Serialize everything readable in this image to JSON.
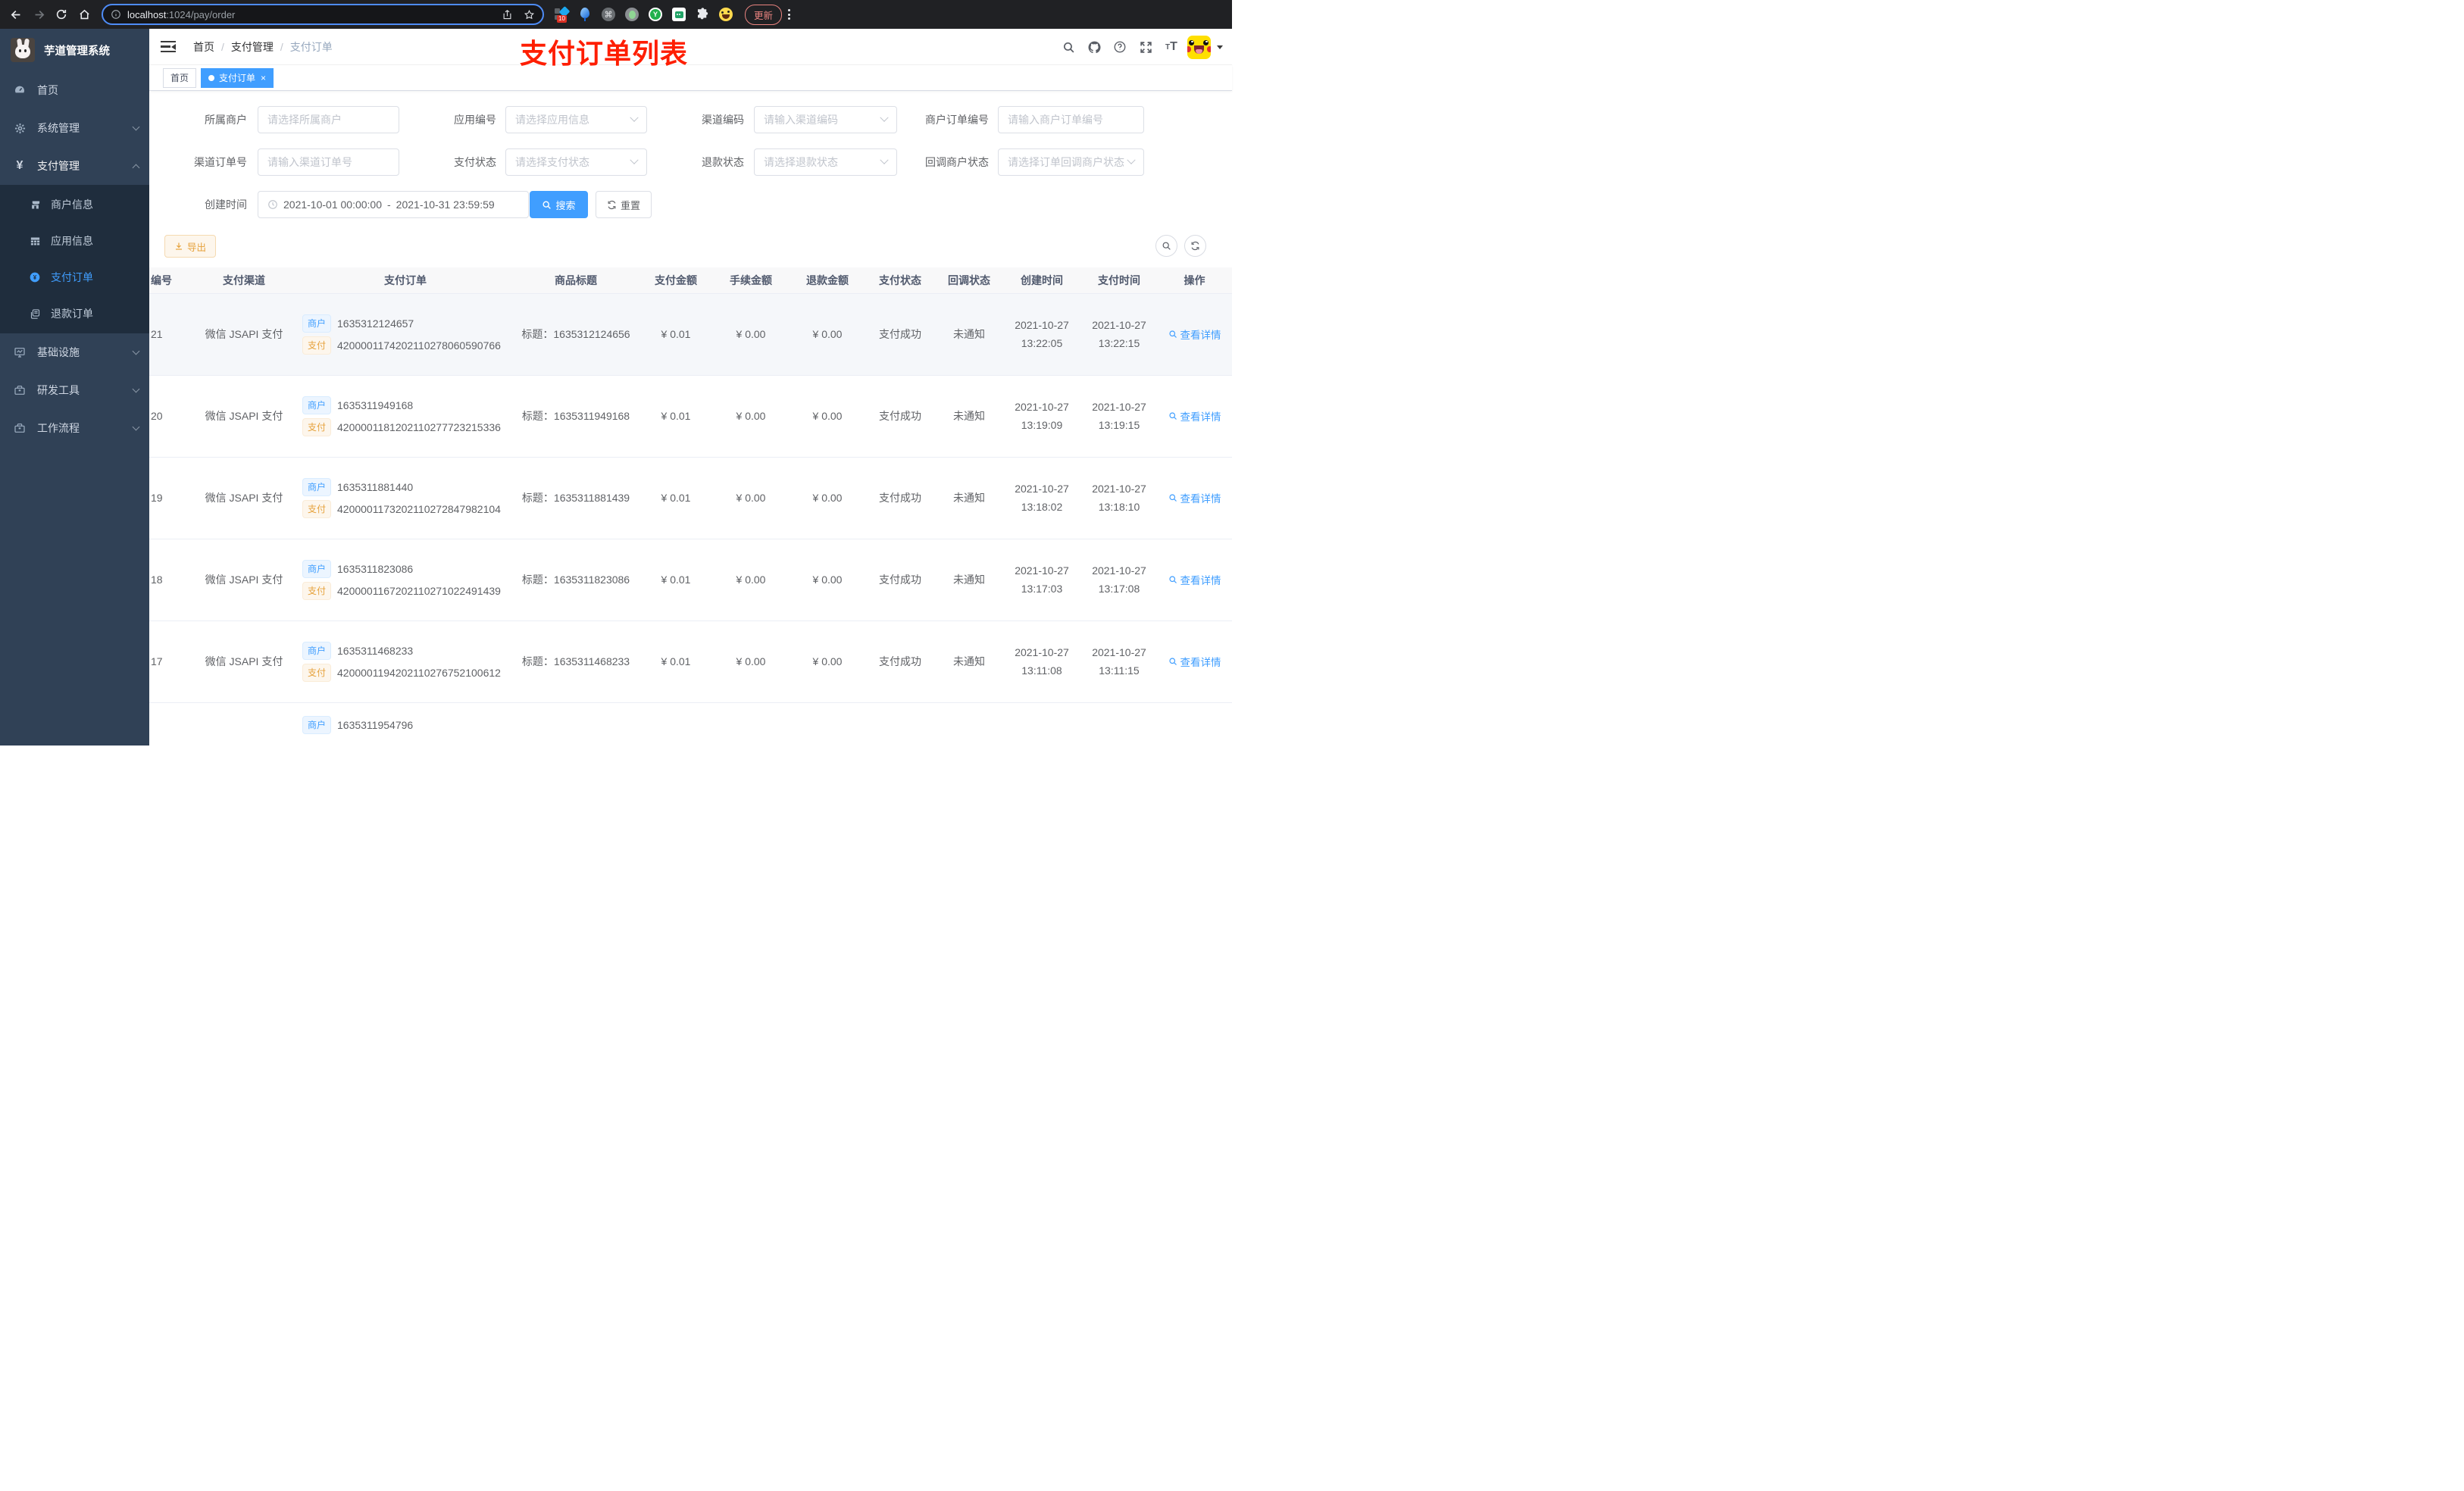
{
  "browser": {
    "url_host": "localhost",
    "url_rest": ":1024/pay/order",
    "ext_badge": "10",
    "ext_y": "Y",
    "update_label": "更新"
  },
  "sidebar": {
    "app_title": "芋道管理系统",
    "menu_home": "首页",
    "menu_system": "系统管理",
    "menu_pay": "支付管理",
    "sub_merchant": "商户信息",
    "sub_app": "应用信息",
    "sub_pay_order": "支付订单",
    "sub_refund_order": "退款订单",
    "menu_infra": "基础设施",
    "menu_devtool": "研发工具",
    "menu_workflow": "工作流程"
  },
  "navbar": {
    "breadcrumb_home": "首页",
    "breadcrumb_pay": "支付管理",
    "breadcrumb_order": "支付订单",
    "annotation": "支付订单列表"
  },
  "tags": {
    "home": "首页",
    "active": "支付订单",
    "close": "×"
  },
  "filters": {
    "merchant": {
      "label": "所属商户",
      "placeholder": "请选择所属商户"
    },
    "app": {
      "label": "应用编号",
      "placeholder": "请选择应用信息"
    },
    "channel_code": {
      "label": "渠道编码",
      "placeholder": "请输入渠道编码"
    },
    "merchant_order_no": {
      "label": "商户订单编号",
      "placeholder": "请输入商户订单编号"
    },
    "channel_order_no": {
      "label": "渠道订单号",
      "placeholder": "请输入渠道订单号"
    },
    "pay_status": {
      "label": "支付状态",
      "placeholder": "请选择支付状态"
    },
    "refund_status": {
      "label": "退款状态",
      "placeholder": "请选择退款状态"
    },
    "callback_status": {
      "label": "回调商户状态",
      "placeholder": "请选择订单回调商户状态"
    },
    "create_time": {
      "label": "创建时间",
      "start": "2021-10-01 00:00:00",
      "separator": "-",
      "end": "2021-10-31 23:59:59"
    },
    "search_label": "搜索",
    "reset_label": "重置"
  },
  "toolbar": {
    "export_label": "导出"
  },
  "table": {
    "headers": [
      "编号",
      "支付渠道",
      "支付订单",
      "商品标题",
      "支付金额",
      "手续金额",
      "退款金额",
      "支付状态",
      "回调状态",
      "创建时间",
      "支付时间",
      "操作"
    ],
    "tag_merchant": "商户",
    "tag_pay": "支付",
    "title_prefix": "标题：",
    "rows": [
      {
        "id": "21",
        "channel": "微信 JSAPI 支付",
        "mch_no": "1635312124657",
        "pay_no": "4200001174202110278060590766",
        "title": "1635312124656",
        "amount": "¥ 0.01",
        "fee": "¥ 0.00",
        "refund": "¥ 0.00",
        "status": "支付成功",
        "notify": "未通知",
        "create_date": "2021-10-27",
        "create_time": "13:22:05",
        "pay_date": "2021-10-27",
        "pay_time": "13:22:15",
        "action": "查看详情"
      },
      {
        "id": "20",
        "channel": "微信 JSAPI 支付",
        "mch_no": "1635311949168",
        "pay_no": "4200001181202110277723215336",
        "title": "1635311949168",
        "amount": "¥ 0.01",
        "fee": "¥ 0.00",
        "refund": "¥ 0.00",
        "status": "支付成功",
        "notify": "未通知",
        "create_date": "2021-10-27",
        "create_time": "13:19:09",
        "pay_date": "2021-10-27",
        "pay_time": "13:19:15",
        "action": "查看详情"
      },
      {
        "id": "19",
        "channel": "微信 JSAPI 支付",
        "mch_no": "1635311881440",
        "pay_no": "4200001173202110272847982104",
        "title": "1635311881439",
        "amount": "¥ 0.01",
        "fee": "¥ 0.00",
        "refund": "¥ 0.00",
        "status": "支付成功",
        "notify": "未通知",
        "create_date": "2021-10-27",
        "create_time": "13:18:02",
        "pay_date": "2021-10-27",
        "pay_time": "13:18:10",
        "action": "查看详情"
      },
      {
        "id": "18",
        "channel": "微信 JSAPI 支付",
        "mch_no": "1635311823086",
        "pay_no": "4200001167202110271022491439",
        "title": "1635311823086",
        "amount": "¥ 0.01",
        "fee": "¥ 0.00",
        "refund": "¥ 0.00",
        "status": "支付成功",
        "notify": "未通知",
        "create_date": "2021-10-27",
        "create_time": "13:17:03",
        "pay_date": "2021-10-27",
        "pay_time": "13:17:08",
        "action": "查看详情"
      },
      {
        "id": "17",
        "channel": "微信 JSAPI 支付",
        "mch_no": "1635311468233",
        "pay_no": "4200001194202110276752100612",
        "title": "1635311468233",
        "amount": "¥ 0.01",
        "fee": "¥ 0.00",
        "refund": "¥ 0.00",
        "status": "支付成功",
        "notify": "未通知",
        "create_date": "2021-10-27",
        "create_time": "13:11:08",
        "pay_date": "2021-10-27",
        "pay_time": "13:11:15",
        "action": "查看详情"
      }
    ],
    "partial_row": {
      "mch_no": "1635311954796"
    }
  }
}
